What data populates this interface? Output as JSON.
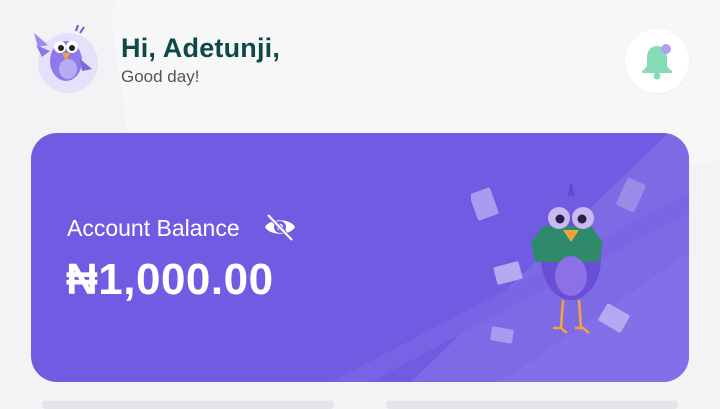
{
  "header": {
    "greeting": "Hi, Adetunji,",
    "subtitle": "Good day!",
    "avatar_icon": "bird-avatar",
    "notification_icon": "bell-icon",
    "notification_color": "#86dcb7",
    "notification_dot_color": "#b29cf5"
  },
  "balance_card": {
    "label": "Account Balance",
    "amount": "₦1,000.00",
    "visibility_icon": "eye-slash-icon",
    "background": "#725be3",
    "mascot_icon": "bird-with-cash-illustration"
  }
}
